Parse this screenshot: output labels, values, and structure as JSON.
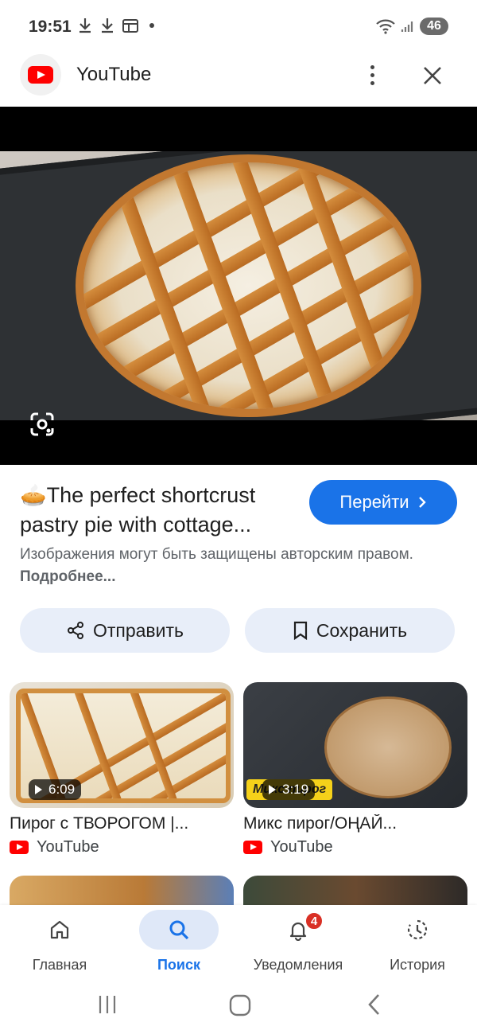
{
  "status_bar": {
    "time": "19:51",
    "battery": "46"
  },
  "header": {
    "app_title": "YouTube"
  },
  "result": {
    "title": "🥧The perfect shortcrust pastry pie with cottage...",
    "goto_label": "Перейти",
    "copyright_text": "Изображения могут быть защищены авторским правом.",
    "more_link": "Подробнее..."
  },
  "actions": {
    "share_label": "Отправить",
    "save_label": "Сохранить"
  },
  "related": [
    {
      "title": "Пирог с ТВОРОГОМ |...",
      "source": "YouTube",
      "duration": "6:09"
    },
    {
      "title": "Микс пирог/ОҢАЙ...",
      "source": "YouTube",
      "duration": "3:19",
      "overlay_text": "Микс пирог"
    }
  ],
  "bottom_nav": [
    {
      "label": "Главная",
      "icon": "home-icon"
    },
    {
      "label": "Поиск",
      "icon": "search-icon",
      "active": true
    },
    {
      "label": "Уведомления",
      "icon": "bell-icon",
      "badge": "4"
    },
    {
      "label": "История",
      "icon": "history-icon"
    }
  ],
  "colors": {
    "accent": "#1a73e8",
    "youtube_red": "#ff0000",
    "chip_bg": "#e8eef9",
    "badge": "#d93025"
  }
}
